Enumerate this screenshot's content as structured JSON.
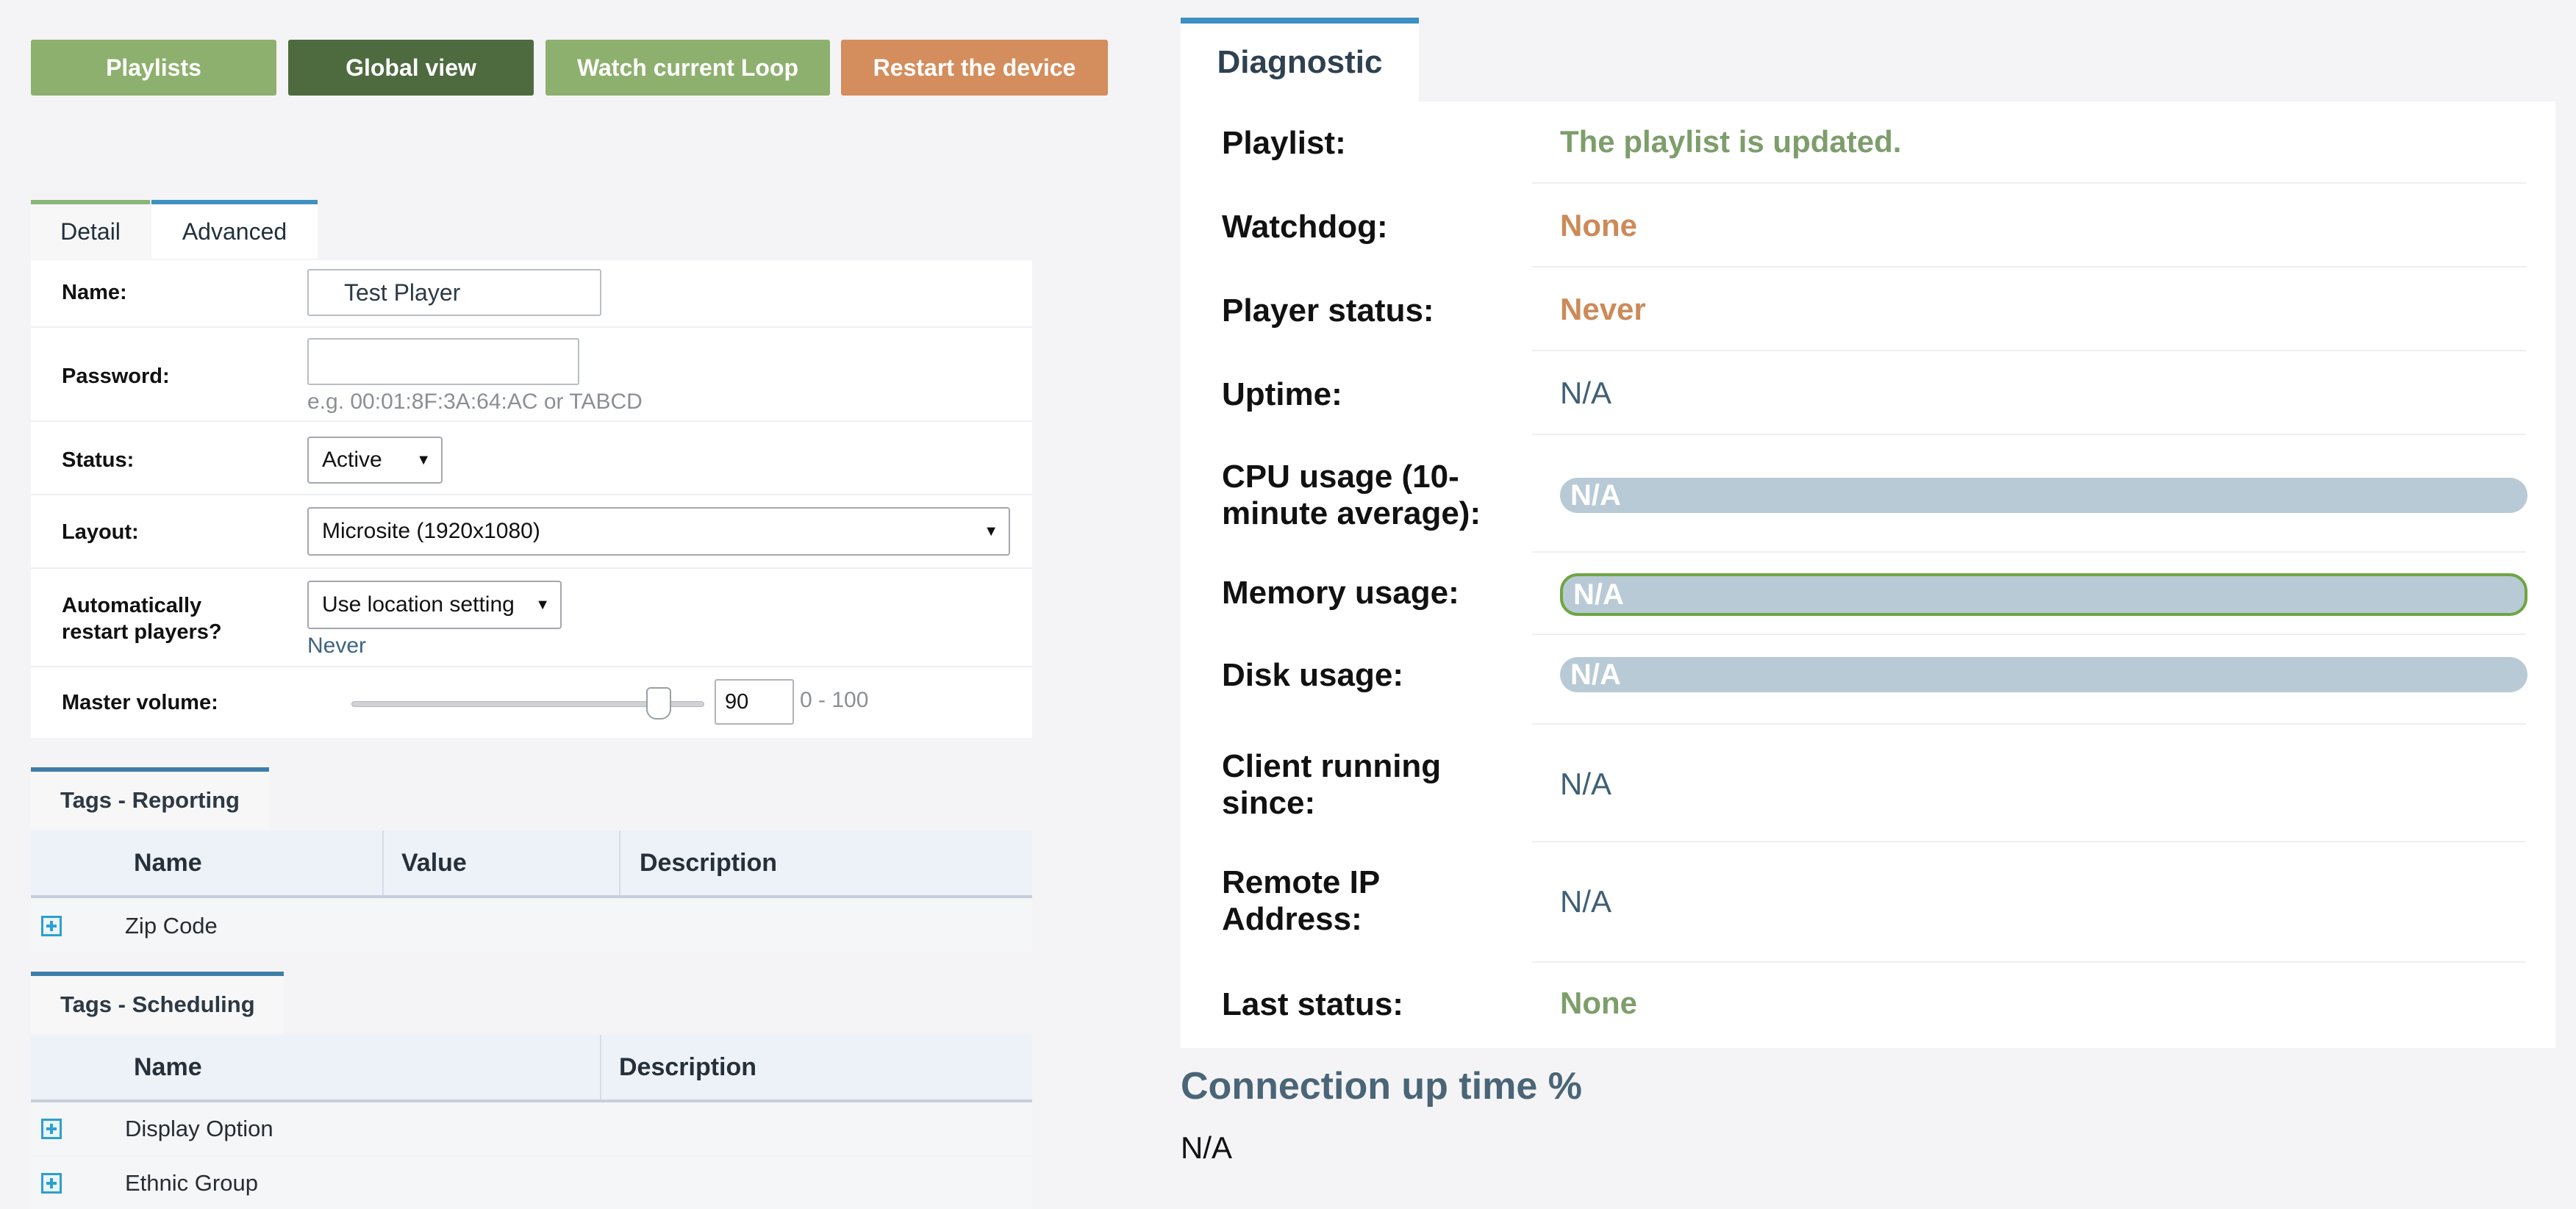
{
  "toolbar": {
    "playlists": "Playlists",
    "global_view": "Global view",
    "watch_loop": "Watch current Loop",
    "restart": "Restart the device"
  },
  "tabs": {
    "detail": "Detail",
    "advanced": "Advanced"
  },
  "form": {
    "name_label": "Name:",
    "name_value": "Test Player",
    "password_label": "Password:",
    "password_value": "",
    "password_hint": "e.g. 00:01:8F:3A:64:AC or TABCD",
    "status_label": "Status:",
    "status_value": "Active",
    "layout_label": "Layout:",
    "layout_value": "Microsite (1920x1080)",
    "restart_label_1": "Automatically",
    "restart_label_2": "restart players?",
    "restart_value": "Use location setting",
    "restart_hint": "Never",
    "volume_label": "Master volume:",
    "volume_value": "90",
    "volume_range": "0 - 100",
    "volume_level": 90
  },
  "tags_reporting": {
    "title": "Tags - Reporting",
    "columns": [
      "Name",
      "Value",
      "Description"
    ],
    "rows": [
      "Zip Code"
    ]
  },
  "tags_scheduling": {
    "title": "Tags - Scheduling",
    "columns": [
      "Name",
      "Description"
    ],
    "rows": [
      "Display Option",
      "Ethnic Group"
    ]
  },
  "diagnostic": {
    "title": "Diagnostic",
    "playlist_label": "Playlist:",
    "playlist_value": "The playlist is updated.",
    "watchdog_label": "Watchdog:",
    "watchdog_value": "None",
    "player_status_label": "Player status:",
    "player_status_value": "Never",
    "uptime_label": "Uptime:",
    "uptime_value": "N/A",
    "cpu_label_1": "CPU usage (10-",
    "cpu_label_2": "minute average):",
    "cpu_value": "N/A",
    "memory_label": "Memory usage:",
    "memory_value": "N/A",
    "disk_label": "Disk usage:",
    "disk_value": "N/A",
    "client_label_1": "Client running",
    "client_label_2": "since:",
    "client_value": "N/A",
    "ip_label_1": "Remote IP",
    "ip_label_2": "Address:",
    "ip_value": "N/A",
    "last_status_label": "Last status:",
    "last_status_value": "None"
  },
  "connection": {
    "title": "Connection up time %",
    "value": "N/A"
  },
  "colors": {
    "button_green": "#8eb06e",
    "button_dark_green": "#4e6b3f",
    "button_orange": "#d48d5c",
    "tab_accent_green": "#8ab47a",
    "tab_accent_blue": "#3f8fc0",
    "status_green": "#7d9e6b",
    "status_orange": "#cc8a58",
    "na_blue": "#3f5f75"
  }
}
